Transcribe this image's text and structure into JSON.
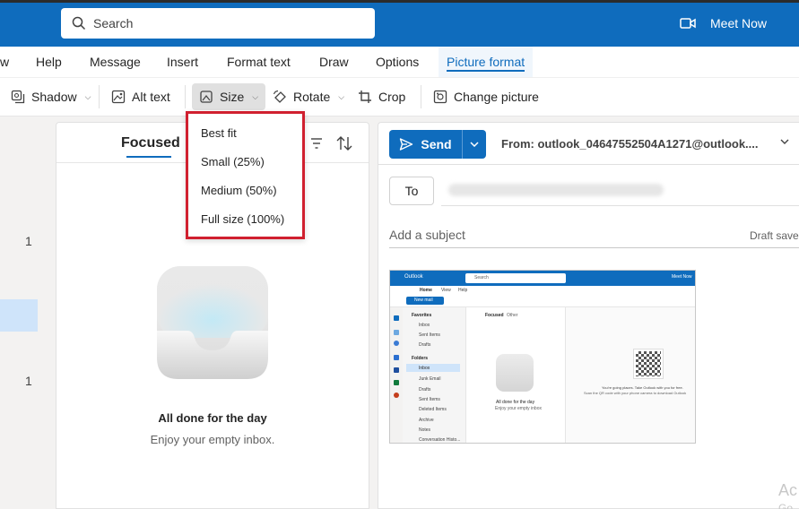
{
  "header": {
    "search_placeholder": "Search",
    "meet_now_label": "Meet Now",
    "colors": {
      "brand": "#0f6cbd"
    }
  },
  "menu": {
    "items": [
      "w",
      "Help",
      "Message",
      "Insert",
      "Format text",
      "Draw",
      "Options",
      "Picture format"
    ],
    "active": "Picture format"
  },
  "ribbon": {
    "shadow": "Shadow",
    "alt_text": "Alt text",
    "size": "Size",
    "rotate": "Rotate",
    "crop": "Crop",
    "change_picture": "Change picture"
  },
  "size_menu": {
    "options": [
      "Best fit",
      "Small (25%)",
      "Medium (50%)",
      "Full size (100%)"
    ]
  },
  "leftnav": {
    "badge_1": "1",
    "badge_2": "1"
  },
  "message_list": {
    "tab": "Focused",
    "empty_title": "All done for the day",
    "empty_subtitle": "Enjoy your empty inbox."
  },
  "compose": {
    "send_label": "Send",
    "from_label": "From: outlook_04647552504A1271@outlook....",
    "to_label": "To",
    "subject_placeholder": "Add a subject",
    "draft_status": "Draft saved",
    "watermark_line1": "Ac",
    "watermark_line2": "Go"
  },
  "thumbnail": {
    "app_name": "Outlook",
    "search": "Search",
    "meet_now": "Meet Now",
    "tabs": [
      "Home",
      "View",
      "Help"
    ],
    "new_mail": "New mail",
    "favorites": "Favorites",
    "fav_items": [
      "Inbox",
      "Sent Items",
      "Drafts"
    ],
    "folders": "Folders",
    "folder_items": [
      "Inbox",
      "Junk Email",
      "Drafts",
      "Sent Items",
      "Deleted Items",
      "Archive",
      "Notes",
      "Conversation Histo..."
    ],
    "focused": "Focused",
    "other": "Other",
    "empty_title": "All done for the day",
    "empty_sub": "Enjoy your empty inbox",
    "qr_line1": "You're going places. Take Outlook with you for free.",
    "qr_line2": "Scan the QR code with your phone camera to download Outlook"
  }
}
